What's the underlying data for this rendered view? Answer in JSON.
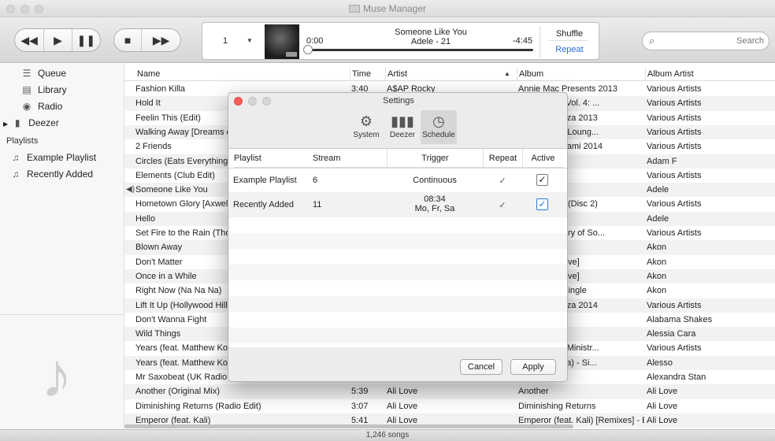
{
  "window": {
    "title": "Muse Manager"
  },
  "player": {
    "playlist_number": "1",
    "elapsed": "0:00",
    "remaining": "-4:45",
    "song_title": "Someone Like You",
    "song_artist_album": "Adele - 21",
    "shuffle_label": "Shuffle",
    "repeat_label": "Repeat",
    "progress": 0.0
  },
  "search": {
    "placeholder": "Search"
  },
  "sidebar": {
    "items": [
      {
        "label": "Queue",
        "icon": "queue-icon"
      },
      {
        "label": "Library",
        "icon": "library-icon"
      },
      {
        "label": "Radio",
        "icon": "radio-icon"
      },
      {
        "label": "Deezer",
        "icon": "deezer-icon"
      }
    ],
    "playlists_header": "Playlists",
    "playlists": [
      {
        "label": "Example Playlist",
        "icon": "playlist-icon"
      },
      {
        "label": "Recently Added",
        "icon": "playlist-icon"
      }
    ]
  },
  "table": {
    "columns": [
      "Name",
      "Time",
      "Artist",
      "Album",
      "Album Artist"
    ],
    "rows": [
      {
        "name": "Fashion Killa",
        "time": "3:40",
        "artist": "A$AP Rocky",
        "album": "Annie Mac Presents 2013",
        "album_artist": "Various Artists"
      },
      {
        "name": "Hold It",
        "time": "",
        "artist": "",
        "album": "& Defected, Vol. 4: ...",
        "album_artist": "Various Artists"
      },
      {
        "name": "Feelin This (Edit)",
        "time": "",
        "artist": "",
        "album": "he House Ibiza 2013",
        "album_artist": "Various Artists"
      },
      {
        "name": "Walking Away [Dreams c",
        "time": "",
        "artist": "",
        "album": "out [Buddha Loung...",
        "album_artist": "Various Artists"
      },
      {
        "name": "2 Friends",
        "time": "",
        "artist": "",
        "album": "he House Miami 2014",
        "album_artist": "Various Artists"
      },
      {
        "name": "Circles (Eats Everything",
        "time": "",
        "artist": "",
        "album": "",
        "album_artist": "Adam F"
      },
      {
        "name": "Elements (Club Edit)",
        "time": "",
        "artist": "",
        "album": "lture 2",
        "album_artist": "Various Artists"
      },
      {
        "name": "Someone Like You",
        "time": "",
        "artist": "",
        "album": "",
        "album_artist": "Adele"
      },
      {
        "name": "Hometown Glory [Axwel",
        "time": "",
        "artist": "",
        "album": "he Mix 2009 (Disc 2)",
        "album_artist": "Various Artists"
      },
      {
        "name": "Hello",
        "time": "",
        "artist": "",
        "album": "e",
        "album_artist": "Adele"
      },
      {
        "name": "Set Fire to the Rain (Tho",
        "time": "",
        "artist": "",
        "album": "2012 - Ministry of So...",
        "album_artist": "Various Artists"
      },
      {
        "name": "Blown Away",
        "time": "",
        "artist": "",
        "album": "",
        "album_artist": "Akon"
      },
      {
        "name": "Don't Matter",
        "time": "",
        "artist": "",
        "album": "arget Exclusive]",
        "album_artist": "Akon"
      },
      {
        "name": "Once in a While",
        "time": "",
        "artist": "",
        "album": "arget Exclusive]",
        "album_artist": "Akon"
      },
      {
        "name": "Right Now (Na Na Na)",
        "time": "",
        "artist": "",
        "album": "la Na Na) - Single",
        "album_artist": "Akon"
      },
      {
        "name": "Lift It Up (Hollywood Hill",
        "time": "",
        "artist": "",
        "album": "he House Ibiza 2014",
        "album_artist": "Various Artists"
      },
      {
        "name": "Don't Wanna Fight",
        "time": "",
        "artist": "",
        "album": "or",
        "album_artist": "Alabama Shakes"
      },
      {
        "name": "Wild Things",
        "time": "",
        "artist": "",
        "album": "- Single",
        "album_artist": "Alessia Cara"
      },
      {
        "name": "Years (feat. Matthew Ko",
        "time": "",
        "artist": "",
        "album": "Bass 2013 - Ministr...",
        "album_artist": "Various Artists"
      },
      {
        "name": "Years (feat. Matthew Ko",
        "time": "",
        "artist": "",
        "album": "fatthew Koma) - Si...",
        "album_artist": "Alesso"
      },
      {
        "name": "Mr Saxobeat (UK Radio I",
        "time": "",
        "artist": "",
        "album": "- EP",
        "album_artist": "Alexandra Stan"
      },
      {
        "name": "Another (Original Mix)",
        "time": "5:39",
        "artist": "Ali Love",
        "album": "Another",
        "album_artist": "Ali Love"
      },
      {
        "name": "Diminishing Returns (Radio Edit)",
        "time": "3:07",
        "artist": "Ali Love",
        "album": "Diminishing Returns",
        "album_artist": "Ali Love"
      },
      {
        "name": "Emperor (feat. Kali)",
        "time": "5:41",
        "artist": "Ali Love",
        "album": "Emperor (feat. Kali) [Remixes] - EP",
        "album_artist": "Ali Love"
      }
    ]
  },
  "status": {
    "song_count": "1,246 songs"
  },
  "settings": {
    "title": "Settings",
    "tabs": [
      {
        "label": "System",
        "icon": "gears-icon"
      },
      {
        "label": "Deezer",
        "icon": "deezer-icon"
      },
      {
        "label": "Schedule",
        "icon": "clock-icon"
      }
    ],
    "columns": [
      "Playlist",
      "Stream",
      "Trigger",
      "Repeat",
      "Active"
    ],
    "rows": [
      {
        "playlist": "Example Playlist",
        "stream": "6",
        "trigger_line1": "Continuous",
        "trigger_line2": "",
        "repeat": "✓",
        "active": true
      },
      {
        "playlist": "Recently Added",
        "stream": "11",
        "trigger_line1": "08:34",
        "trigger_line2": "Mo, Fr, Sa",
        "repeat": "✓",
        "active": true
      }
    ],
    "cancel_label": "Cancel",
    "apply_label": "Apply"
  }
}
